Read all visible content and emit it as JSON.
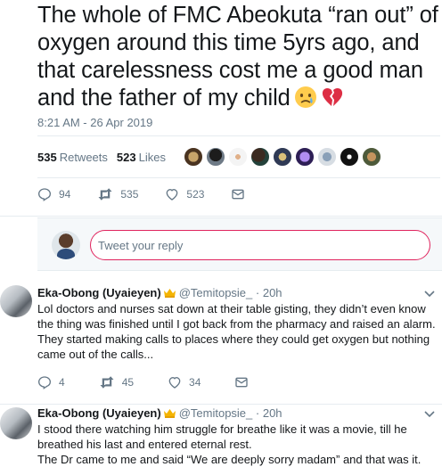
{
  "main_tweet": {
    "text": "The whole of FMC Abeokuta “ran out” of oxygen around this time 5yrs ago, and that carelessness cost me a good man and the father of my child",
    "emoji_1": "crying-face",
    "emoji_2": "broken-heart",
    "timestamp": "8:21 AM - 26 Apr 2019",
    "retweets_count": "535",
    "retweets_label": "Retweets",
    "likes_count": "523",
    "likes_label": "Likes",
    "actions": {
      "replies": "94",
      "retweets": "535",
      "likes": "523"
    }
  },
  "reply_box": {
    "placeholder": "Tweet your reply"
  },
  "replies": [
    {
      "name": "Eka-Obong (Uyaieyen)",
      "handle": "@Temitopsie_",
      "time": "· 20h",
      "text": "Lol doctors and nurses sat down at their table gisting, they didn’t even know the thing was finished until I got back from the pharmacy and raised an alarm. They started making calls to places where they could get oxygen but nothing came out of the calls...",
      "replies": "4",
      "retweets": "45",
      "likes": "34"
    },
    {
      "name": "Eka-Obong (Uyaieyen)",
      "handle": "@Temitopsie_",
      "time": "· 20h",
      "text_line_1": "I stood there watching him struggle for breathe like it was a movie, till he breathed his last and entered eternal rest.",
      "text_line_2": "The Dr came to me and said “We are deeply sorry madam” and that was it."
    }
  ],
  "colors": {
    "text": "#14171a",
    "secondary": "#657786",
    "border": "#e6ecf0",
    "reply_border": "#e0245e",
    "background": "#f5f8fa"
  }
}
